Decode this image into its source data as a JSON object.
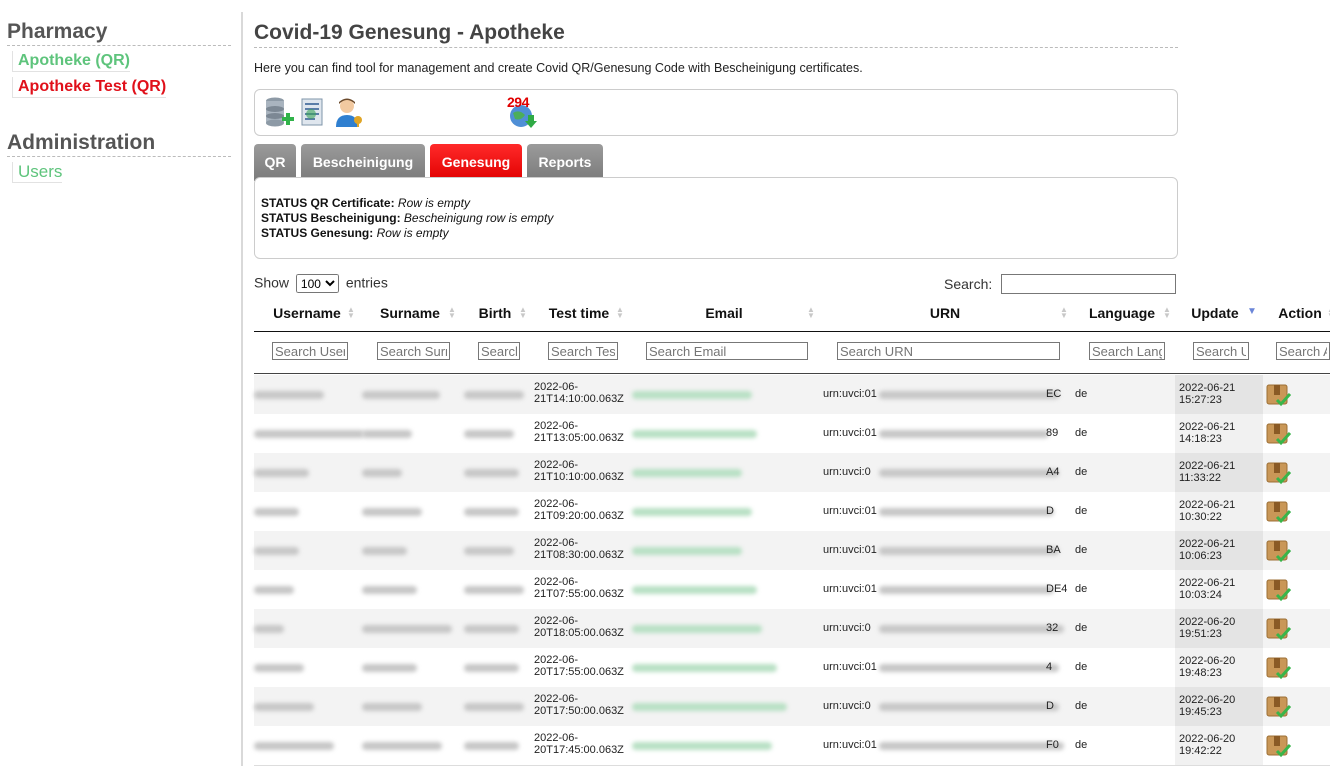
{
  "sidebar": {
    "pharmacy_title": "Pharmacy",
    "pharmacy_links": [
      "Apotheke (QR)",
      "Apotheke Test (QR)"
    ],
    "admin_title": "Administration",
    "admin_links": [
      "Users"
    ]
  },
  "page": {
    "title": "Covid-19 Genesung - Apotheke",
    "intro": "Here you can find tool for management and create Covid QR/Genesung Code with Bescheinigung certificates."
  },
  "toolbar": {
    "icons": [
      "database-add-icon",
      "document-list-icon",
      "user-key-icon",
      "globe-download-icon"
    ],
    "badge": "294"
  },
  "tabs": [
    {
      "label": "QR",
      "active": false
    },
    {
      "label": "Bescheinigung",
      "active": false
    },
    {
      "label": "Genesung",
      "active": true
    },
    {
      "label": "Reports",
      "active": false
    }
  ],
  "status": [
    {
      "label": "STATUS QR Certificate:",
      "value": "Row is empty"
    },
    {
      "label": "STATUS Bescheinigung:",
      "value": "Bescheinigung row is empty"
    },
    {
      "label": "STATUS Genesung:",
      "value": "Row is empty"
    }
  ],
  "table_controls": {
    "show_prefix": "Show",
    "show_value": "100",
    "show_suffix": "entries",
    "search_label": "Search:"
  },
  "columns": [
    {
      "label": "Username",
      "placeholder": "Search Username"
    },
    {
      "label": "Surname",
      "placeholder": "Search Surname"
    },
    {
      "label": "Birth",
      "placeholder": "Search Birth"
    },
    {
      "label": "Test time",
      "placeholder": "Search Test time"
    },
    {
      "label": "Email",
      "placeholder": "Search Email"
    },
    {
      "label": "URN",
      "placeholder": "Search URN"
    },
    {
      "label": "Language",
      "placeholder": "Search Language"
    },
    {
      "label": "Update",
      "placeholder": "Search Update"
    },
    {
      "label": "Action",
      "placeholder": "Search Action"
    }
  ],
  "sort_active_column": "Update",
  "rows": [
    {
      "time1": "2022-06-",
      "time2": "21T14:10:00.063Z",
      "urn_prefix": "urn:uvci:01",
      "urn_suffix": "EC",
      "lang": "de",
      "upd1": "2022-06-21",
      "upd2": "15:27:23"
    },
    {
      "time1": "2022-06-",
      "time2": "21T13:05:00.063Z",
      "urn_prefix": "urn:uvci:01",
      "urn_suffix": "89",
      "lang": "de",
      "upd1": "2022-06-21",
      "upd2": "14:18:23"
    },
    {
      "time1": "2022-06-",
      "time2": "21T10:10:00.063Z",
      "urn_prefix": "urn:uvci:0",
      "urn_suffix": "A4",
      "lang": "de",
      "upd1": "2022-06-21",
      "upd2": "11:33:22"
    },
    {
      "time1": "2022-06-",
      "time2": "21T09:20:00.063Z",
      "urn_prefix": "urn:uvci:01",
      "urn_suffix": "D",
      "lang": "de",
      "upd1": "2022-06-21",
      "upd2": "10:30:22"
    },
    {
      "time1": "2022-06-",
      "time2": "21T08:30:00.063Z",
      "urn_prefix": "urn:uvci:01",
      "urn_suffix": "BA",
      "lang": "de",
      "upd1": "2022-06-21",
      "upd2": "10:06:23"
    },
    {
      "time1": "2022-06-",
      "time2": "21T07:55:00.063Z",
      "urn_prefix": "urn:uvci:01",
      "urn_suffix": "DE4",
      "lang": "de",
      "upd1": "2022-06-21",
      "upd2": "10:03:24"
    },
    {
      "time1": "2022-06-",
      "time2": "20T18:05:00.063Z",
      "urn_prefix": "urn:uvci:0",
      "urn_suffix": "32",
      "lang": "de",
      "upd1": "2022-06-20",
      "upd2": "19:51:23"
    },
    {
      "time1": "2022-06-",
      "time2": "20T17:55:00.063Z",
      "urn_prefix": "urn:uvci:01",
      "urn_suffix": "4",
      "lang": "de",
      "upd1": "2022-06-20",
      "upd2": "19:48:23"
    },
    {
      "time1": "2022-06-",
      "time2": "20T17:50:00.063Z",
      "urn_prefix": "urn:uvci:0",
      "urn_suffix": "D",
      "lang": "de",
      "upd1": "2022-06-20",
      "upd2": "19:45:23"
    },
    {
      "time1": "2022-06-",
      "time2": "20T17:45:00.063Z",
      "urn_prefix": "urn:uvci:01",
      "urn_suffix": "F0",
      "lang": "de",
      "upd1": "2022-06-20",
      "upd2": "19:42:22"
    }
  ]
}
